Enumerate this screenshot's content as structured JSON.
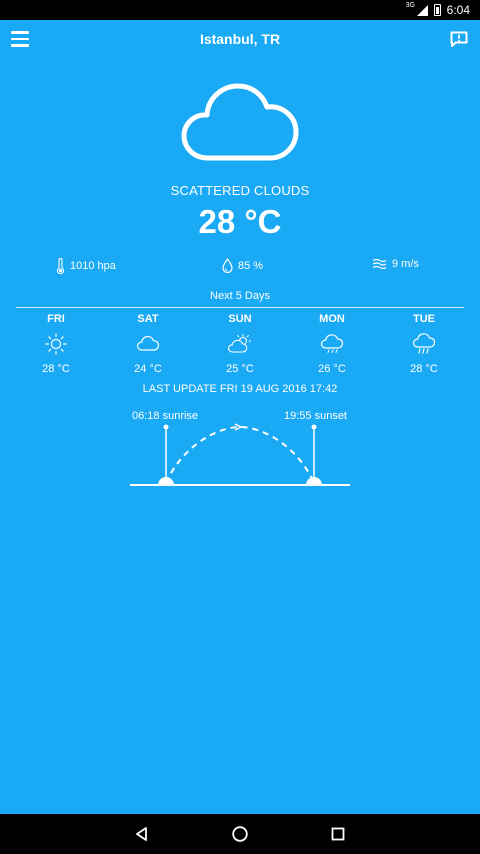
{
  "status_bar": {
    "network": "3G",
    "time": "6:04"
  },
  "header": {
    "title": "Istanbul, TR",
    "menu_icon": "hamburger-icon",
    "feedback_icon": "feedback-icon"
  },
  "current": {
    "icon": "cloud-icon",
    "condition": "SCATTERED CLOUDS",
    "temperature": "28 °C",
    "pressure": "1010 hpa",
    "humidity": "85 %",
    "wind": "9 m/s"
  },
  "forecast": {
    "heading": "Next 5 Days",
    "days": [
      {
        "day": "FRI",
        "icon": "sun-icon",
        "temp": "28 °C"
      },
      {
        "day": "SAT",
        "icon": "cloud-icon",
        "temp": "24 °C"
      },
      {
        "day": "SUN",
        "icon": "partly-cloudy-icon",
        "temp": "25 °C"
      },
      {
        "day": "MON",
        "icon": "cloud-icon",
        "temp": "26 °C"
      },
      {
        "day": "TUE",
        "icon": "rain-cloud-icon",
        "temp": "28 °C"
      }
    ]
  },
  "last_update": "LAST UPDATE FRI 19 AUG 2016 17:42",
  "sun": {
    "sunrise": "06:18 sunrise",
    "sunset": "19:55 sunset"
  },
  "colors": {
    "background": "#1aa9f5",
    "bars": "#000000",
    "foreground": "#ffffff"
  }
}
